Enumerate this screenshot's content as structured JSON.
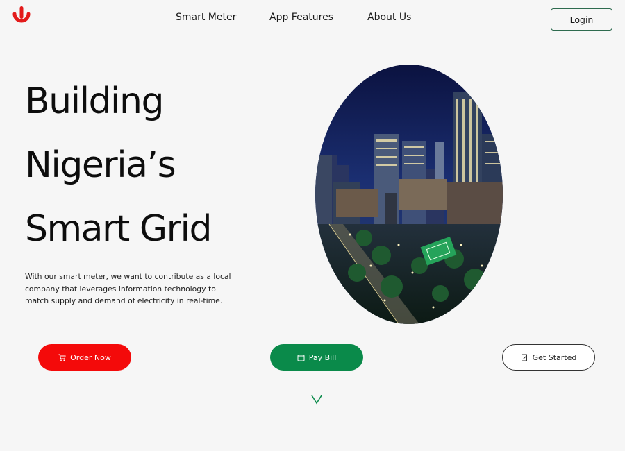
{
  "nav": {
    "items": [
      "Smart Meter",
      "App Features",
      "About Us"
    ],
    "login_label": "Login"
  },
  "hero": {
    "title_lines": [
      "Building",
      "Nigeria’s",
      "Smart Grid"
    ],
    "description": "With our smart meter, we want to contribute as a local company that leverages information technology to match supply and demand of electricity in real-time."
  },
  "actions": {
    "order_label": "Order Now",
    "pay_label": "Pay Bill",
    "start_label": "Get Started"
  },
  "icons": {
    "logo": "power-meter-logo-icon",
    "order": "cart-icon",
    "pay": "wallet-icon",
    "start": "edit-icon",
    "scroll": "chevron-down-icon"
  },
  "colors": {
    "brand_red": "#f40a0a",
    "brand_green": "#0a8a4a",
    "background": "#f6f6f6"
  }
}
